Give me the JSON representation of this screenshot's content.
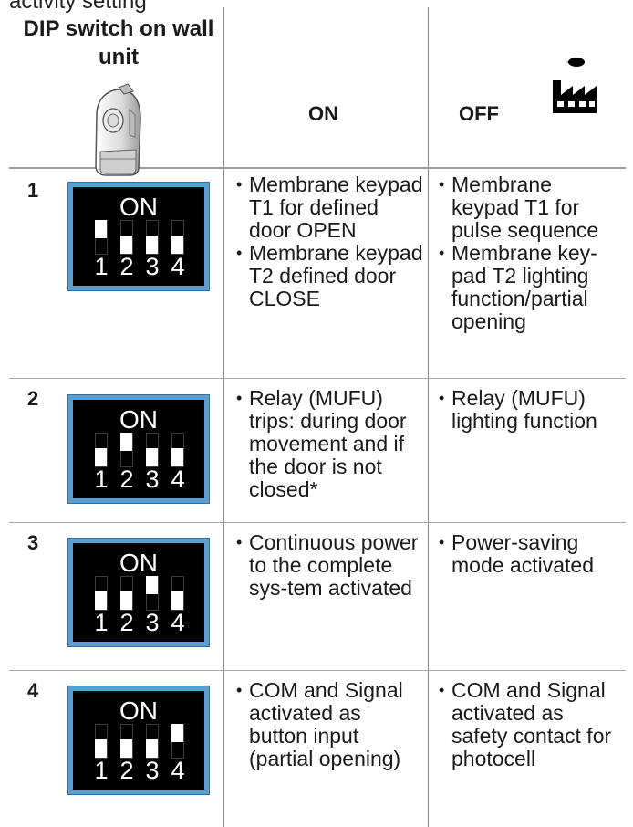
{
  "top_caption": "activity setting",
  "header": {
    "title": "DIP switch on wall unit",
    "on": "ON",
    "off": "OFF"
  },
  "icons": {
    "wall_unit": "wall-unit-device-icon",
    "factory": "factory-icon"
  },
  "colors": {
    "switch_frame": "#5b9fd2",
    "switch_body": "#000000",
    "rules": "#9a9a9a"
  },
  "rows": [
    {
      "number": "1",
      "switch": {
        "label": "ON",
        "positions": [
          "1",
          "2",
          "3",
          "4"
        ],
        "up": [
          true,
          false,
          false,
          false
        ]
      },
      "on_items": [
        "Membrane keypad T1 for defined door OPEN",
        "Membrane keypad T2 defined door CLOSE"
      ],
      "off_items": [
        "Membrane keypad T1 for pulse sequence",
        "Membrane key-pad T2 lighting function/partial opening"
      ]
    },
    {
      "number": "2",
      "switch": {
        "label": "ON",
        "positions": [
          "1",
          "2",
          "3",
          "4"
        ],
        "up": [
          false,
          true,
          false,
          false
        ]
      },
      "on_items": [
        "Relay (MUFU) trips: during door movement and if the door is not closed*"
      ],
      "off_items": [
        "Relay (MUFU) lighting function"
      ]
    },
    {
      "number": "3",
      "switch": {
        "label": "ON",
        "positions": [
          "1",
          "2",
          "3",
          "4"
        ],
        "up": [
          false,
          false,
          true,
          false
        ]
      },
      "on_items": [
        "Continuous power to the complete sys-tem activated"
      ],
      "off_items": [
        "Power-saving mode activated"
      ]
    },
    {
      "number": "4",
      "switch": {
        "label": "ON",
        "positions": [
          "1",
          "2",
          "3",
          "4"
        ],
        "up": [
          false,
          false,
          false,
          true
        ]
      },
      "on_items": [
        "COM and Signal activated as button input (partial opening)"
      ],
      "off_items": [
        "COM and Signal activated as safety contact for photocell"
      ]
    }
  ]
}
